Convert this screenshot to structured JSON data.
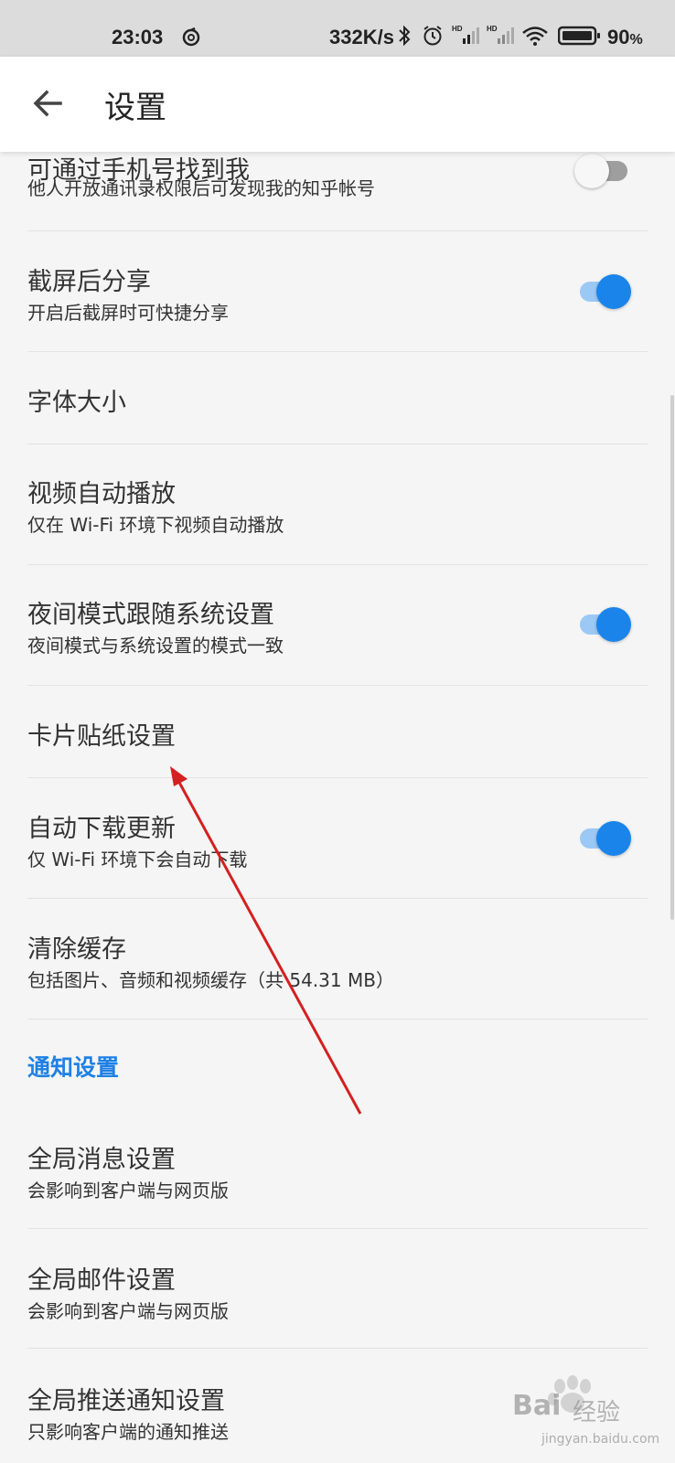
{
  "status_bar": {
    "time": "23:03",
    "net_speed": "332K/s",
    "battery": "90",
    "battery_unit": "%",
    "icons": [
      "netease-music-icon",
      "bluetooth-icon",
      "alarm-icon",
      "signal-hd-icon",
      "signal-hd-icon",
      "wifi-icon",
      "battery-icon"
    ]
  },
  "app_bar": {
    "title": "设置",
    "back_icon": "arrow-left-icon"
  },
  "settings": [
    {
      "id": "find-by-phone",
      "title": "可通过手机号找到我",
      "subtitle": "他人开放通讯录权限后可发现我的知乎帐号",
      "toggle": false
    },
    {
      "id": "share-after-screenshot",
      "title": "截屏后分享",
      "subtitle": "开启后截屏时可快捷分享",
      "toggle": true
    },
    {
      "id": "font-size",
      "title": "字体大小"
    },
    {
      "id": "video-autoplay",
      "title": "视频自动播放",
      "subtitle": "仅在 Wi-Fi 环境下视频自动播放"
    },
    {
      "id": "night-mode",
      "title": "夜间模式跟随系统设置",
      "subtitle": "夜间模式与系统设置的模式一致",
      "toggle": true
    },
    {
      "id": "card-sticker",
      "title": "卡片贴纸设置"
    },
    {
      "id": "auto-update",
      "title": "自动下载更新",
      "subtitle": "仅 Wi-Fi 环境下会自动下载",
      "toggle": true
    },
    {
      "id": "clear-cache",
      "title": "清除缓存",
      "subtitle": "包括图片、音频和视频缓存（共 54.31 MB）"
    }
  ],
  "notification_section": {
    "header": "通知设置",
    "items": [
      {
        "id": "global-message",
        "title": "全局消息设置",
        "subtitle": "会影响到客户端与网页版"
      },
      {
        "id": "global-email",
        "title": "全局邮件设置",
        "subtitle": "会影响到客户端与网页版"
      },
      {
        "id": "global-push",
        "title": "全局推送通知设置",
        "subtitle": "只影响客户端的通知推送"
      }
    ]
  },
  "watermark": {
    "brand": "Bai",
    "brand2": "经验",
    "url": "jingyan.baidu.com"
  },
  "colors": {
    "accent": "#1a84ea",
    "section_header": "#1e80e6",
    "annotation_arrow": "#d42020",
    "background": "#f5f5f5"
  }
}
